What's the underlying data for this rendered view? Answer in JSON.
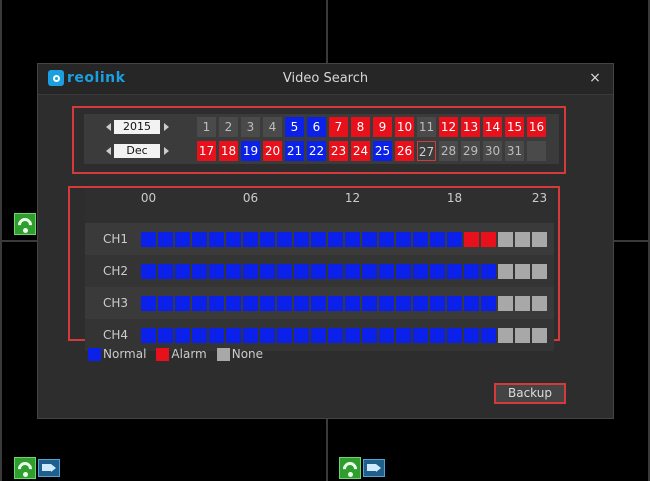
{
  "dialog": {
    "logo_text": "reolink",
    "title": "Video Search",
    "close_label": "×",
    "backup_label": "Backup"
  },
  "calendar": {
    "year": "2015",
    "month": "Dec",
    "row1": [
      {
        "label": "1",
        "state": "none"
      },
      {
        "label": "2",
        "state": "none"
      },
      {
        "label": "3",
        "state": "none"
      },
      {
        "label": "4",
        "state": "none"
      },
      {
        "label": "5",
        "state": "normal"
      },
      {
        "label": "6",
        "state": "normal"
      },
      {
        "label": "7",
        "state": "alarm"
      },
      {
        "label": "8",
        "state": "alarm"
      },
      {
        "label": "9",
        "state": "alarm"
      },
      {
        "label": "10",
        "state": "alarm"
      },
      {
        "label": "11",
        "state": "none"
      },
      {
        "label": "12",
        "state": "alarm"
      },
      {
        "label": "13",
        "state": "alarm"
      },
      {
        "label": "14",
        "state": "alarm"
      },
      {
        "label": "15",
        "state": "alarm"
      },
      {
        "label": "16",
        "state": "alarm"
      }
    ],
    "row2": [
      {
        "label": "17",
        "state": "alarm"
      },
      {
        "label": "18",
        "state": "alarm"
      },
      {
        "label": "19",
        "state": "normal"
      },
      {
        "label": "20",
        "state": "alarm"
      },
      {
        "label": "21",
        "state": "normal"
      },
      {
        "label": "22",
        "state": "normal"
      },
      {
        "label": "23",
        "state": "alarm"
      },
      {
        "label": "24",
        "state": "alarm"
      },
      {
        "label": "25",
        "state": "normal"
      },
      {
        "label": "26",
        "state": "alarm"
      },
      {
        "label": "27",
        "state": "selected"
      },
      {
        "label": "28",
        "state": "none"
      },
      {
        "label": "29",
        "state": "none"
      },
      {
        "label": "30",
        "state": "none"
      },
      {
        "label": "31",
        "state": "none"
      },
      {
        "label": "",
        "state": "none"
      }
    ]
  },
  "timeline": {
    "hour_labels": [
      "00",
      "06",
      "12",
      "18",
      "23"
    ],
    "hour_label_index": [
      0,
      6,
      12,
      18,
      23
    ],
    "channels": [
      {
        "name": "CH1",
        "segments": [
          "normal",
          "normal",
          "normal",
          "normal",
          "normal",
          "normal",
          "normal",
          "normal",
          "normal",
          "normal",
          "normal",
          "normal",
          "normal",
          "normal",
          "normal",
          "normal",
          "normal",
          "normal",
          "normal",
          "alarm",
          "alarm",
          "none",
          "none",
          "none"
        ]
      },
      {
        "name": "CH2",
        "segments": [
          "normal",
          "normal",
          "normal",
          "normal",
          "normal",
          "normal",
          "normal",
          "normal",
          "normal",
          "normal",
          "normal",
          "normal",
          "normal",
          "normal",
          "normal",
          "normal",
          "normal",
          "normal",
          "normal",
          "normal",
          "normal",
          "none",
          "none",
          "none"
        ]
      },
      {
        "name": "CH3",
        "segments": [
          "normal",
          "normal",
          "normal",
          "normal",
          "normal",
          "normal",
          "normal",
          "normal",
          "normal",
          "normal",
          "normal",
          "normal",
          "normal",
          "normal",
          "normal",
          "normal",
          "normal",
          "normal",
          "normal",
          "normal",
          "normal",
          "none",
          "none",
          "none"
        ]
      },
      {
        "name": "CH4",
        "segments": [
          "normal",
          "normal",
          "normal",
          "normal",
          "normal",
          "normal",
          "normal",
          "normal",
          "normal",
          "normal",
          "normal",
          "normal",
          "normal",
          "normal",
          "normal",
          "normal",
          "normal",
          "normal",
          "normal",
          "normal",
          "normal",
          "none",
          "none",
          "none"
        ]
      }
    ]
  },
  "legend": [
    {
      "label": "Normal",
      "color": "#0b20e8"
    },
    {
      "label": "Alarm",
      "color": "#e8101a"
    },
    {
      "label": "None",
      "color": "#a8a8a8"
    }
  ],
  "colors": {
    "normal": "#0b20e8",
    "alarm": "#e8101a",
    "none": "#a8a8a8",
    "accent_border": "#d43a3a",
    "logo": "#1aa0e0"
  },
  "icons": [
    "wifi-icon",
    "camera-icon",
    "spin-left-icon",
    "spin-right-icon",
    "reolink-logo-icon"
  ]
}
